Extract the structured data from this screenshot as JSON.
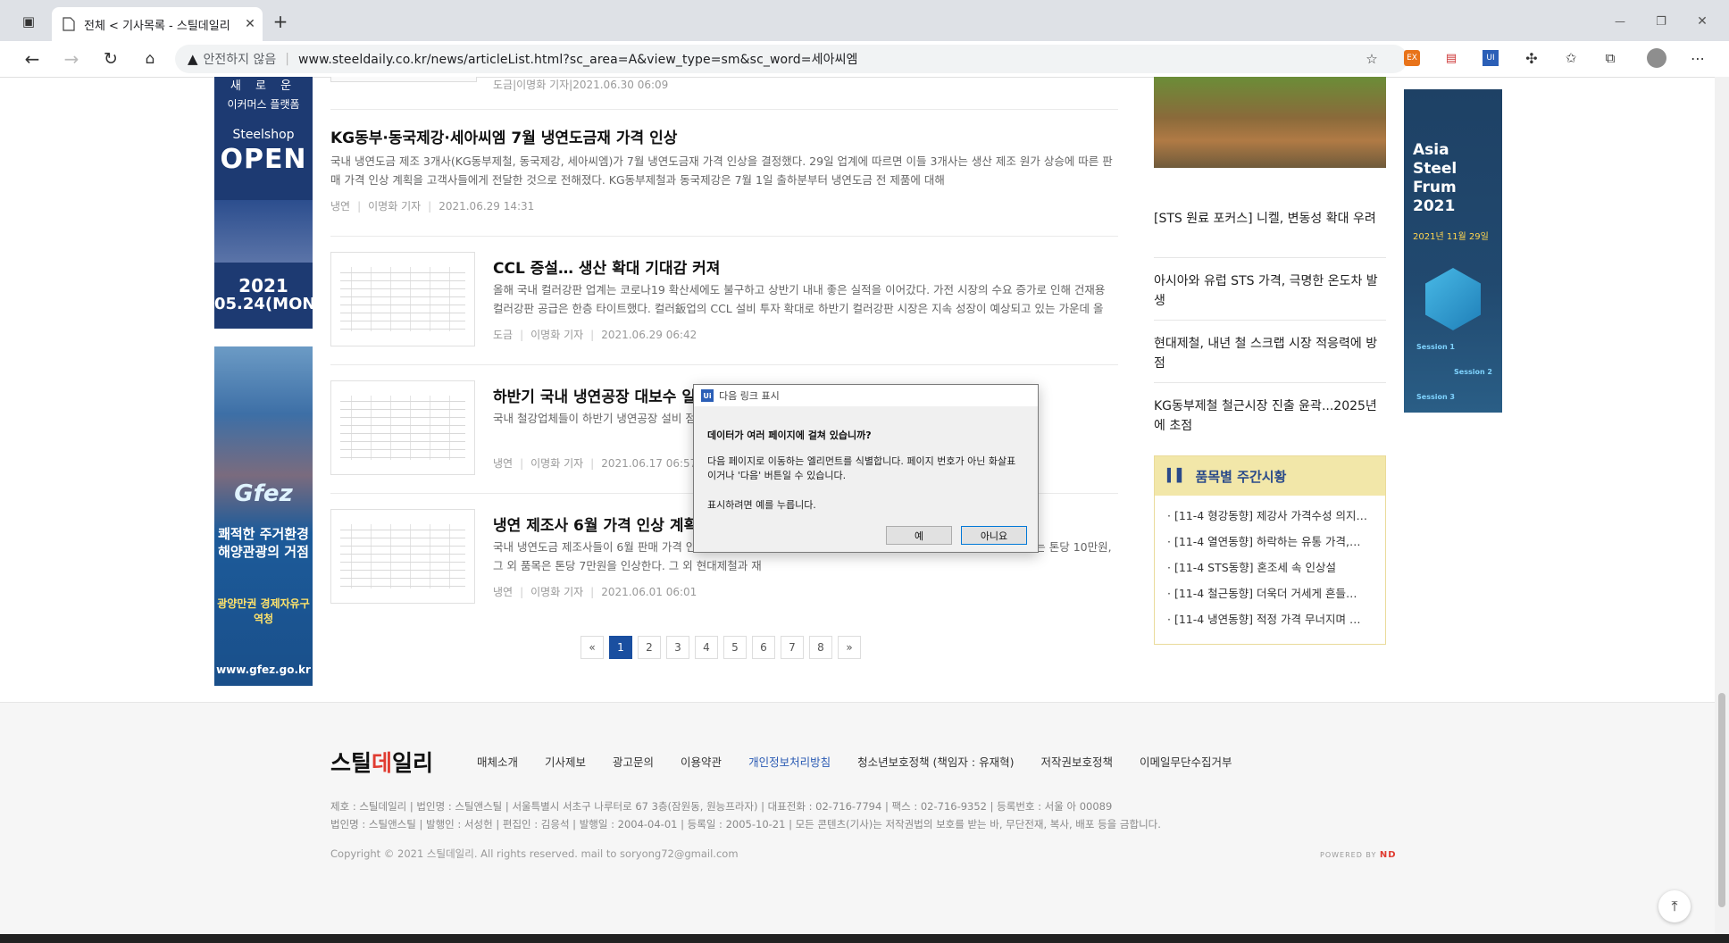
{
  "browser": {
    "tab_title": "전체 < 기사목록 - 스틸데일리",
    "tab_close": "✕",
    "new_tab": "+",
    "insecure_label": "안전하지 않음",
    "url": "www.steeldaily.co.kr/news/articleList.html?sc_area=A&view_type=sm&sc_word=세아씨엠",
    "window_minimize": "—",
    "window_restore": "❐",
    "window_close": "✕"
  },
  "ads": {
    "left_top": {
      "line1": "새 로 운",
      "line2": "이커머스 플랫폼",
      "brand": "Steelshop",
      "open": "OPEN",
      "year": "2021",
      "date": "05.24(MON)"
    },
    "left_bottom": {
      "logo": "Gfez",
      "tagline": "쾌적한 주거환경 해양관광의 거점",
      "name": "광양만권 경제자유구역청",
      "site": "www.gfez.go.kr"
    },
    "right": {
      "title": "Asia Steel Frum 2021",
      "date": "2021년 11월 29일",
      "session1": "Session 1",
      "session2": "Session 2",
      "session3": "Session 3"
    }
  },
  "top_meta": {
    "category": "도금",
    "author": "이명화 기자",
    "date": "2021.06.30 06:09"
  },
  "articles": [
    {
      "title": "KG동부·동국제강·세아씨엠 7월 냉연도금재 가격 인상",
      "summary": "국내 냉연도금 제조 3개사(KG동부제철, 동국제강, 세아씨엠)가 7월 냉연도금재 가격 인상을 결정했다. 29일 업계에 따르면 이들 3개사는 생산 제조 원가 상승에 따른 판매 가격 인상 계획을 고객사들에게 전달한 것으로 전해졌다. KG동부제철과 동국제강은 7월 1일 출하분부터 냉연도금 전 제품에 대해",
      "category": "냉연",
      "author": "이명화 기자",
      "date": "2021.06.29 14:31"
    },
    {
      "title": "CCL 증설… 생산 확대 기대감 커져",
      "summary": "올해 국내 컬러강판 업계는 코로나19 확산세에도 불구하고 상반기 내내 좋은 실적을 이어갔다. 가전 시장의 수요 증가로 인해 건재용 컬러강판 공급은 한층 타이트했다. 컬러鈑업의 CCL 설비 투자 확대로 하반기 컬러강판 시장은 지속 성장이 예상되고 있는 가운데 올",
      "category": "도금",
      "author": "이명화 기자",
      "date": "2021.06.29 06:42"
    },
    {
      "title": "하반기 국내 냉연공장 대보수 일",
      "summary": "국내 철강업체들이 하반기 냉연공장 설비 점검을 실시한 이후 공장 가동률을 최대치로 끌어올려 시 6월 초부터 약",
      "category": "냉연",
      "author": "이명화 기자",
      "date": "2021.06.17 06:57"
    },
    {
      "title": "냉연 제조사 6월 가격 인상 계획",
      "summary": "국내 냉연도금 제조사들이 6월 판매 가격 인 당 15만원이 인상된다. 제조사별로는 포스코가 6월 주문 투입분부터 PO는 톤당 10만원, 그 외 품목은 톤당 7만원을 인상한다. 그 외 현대제철과 재",
      "category": "냉연",
      "author": "이명화 기자",
      "date": "2021.06.01 06:01"
    }
  ],
  "pagination": {
    "prev": "«",
    "pages": [
      "1",
      "2",
      "3",
      "4",
      "5",
      "6",
      "7",
      "8"
    ],
    "active": "1",
    "next": "»"
  },
  "sidebar": {
    "news": [
      "[STS 원료 포커스] 니켈, 변동성 확대 우려",
      "아시아와 유럽 STS 가격, 극명한 온도차 발생",
      "현대제철, 내년 철 스크랩 시장 적응력에 방점",
      "KG동부제철 철근시장 진출 윤곽...2025년에 초점"
    ],
    "weekly_title": "품목별 주간시황",
    "weekly": [
      "[11-4 형강동향] 제강사 가격수성 의지…",
      "[11-4 열연동향] 하락하는 유통 가격,…",
      "[11-4 STS동향] 혼조세 속 인상설",
      "[11-4 철근동향] 더욱더 거세게 흔들…",
      "[11-4 냉연동향] 적정 가격 무너지며 …"
    ]
  },
  "footer": {
    "logo_a": "스틸",
    "logo_b": "데",
    "logo_c": "일리",
    "links": [
      "매체소개",
      "기사제보",
      "광고문의",
      "이용약관",
      "개인정보처리방침",
      "청소년보호정책 (책임자 : 유재혁)",
      "저작권보호정책",
      "이메일무단수집거부"
    ],
    "info1": "제호 : 스틸데일리  |  법인명 : 스틸앤스틸  |  서울특별시 서초구 나루터로 67 3층(잠원동, 원능프라자)  |  대표전화 : 02-716-7794  |  팩스 : 02-716-9352  |  등록번호 : 서울 아 00089",
    "info2": "법인명 : 스틸앤스틸  |  발행인 : 서성헌  |  편집인 : 김응석  |  발행일 : 2004-04-01  |  등록일 : 2005-10-21  |  모든 콘텐츠(기사)는 저작권법의 보호를 받는 바, 무단전재, 복사, 배포 등을 금합니다.",
    "copyright": "Copyright © 2021 스틸데일리. All rights reserved. mail to soryong72@gmail.com",
    "powered": "POWERED BY",
    "powered_brand": "ND"
  },
  "dialog": {
    "title": "다음 링크 표시",
    "question": "데이터가 여러 페이지에 걸쳐 있습니까?",
    "message": "다음 페이지로 이동하는 엘리먼트를 식별합니다. 페이지 번호가 아닌 화살표이거나 '다음' 버튼일 수 있습니다.",
    "hint": "표시하려면 예를 누릅니다.",
    "yes": "예",
    "no": "아니요"
  }
}
